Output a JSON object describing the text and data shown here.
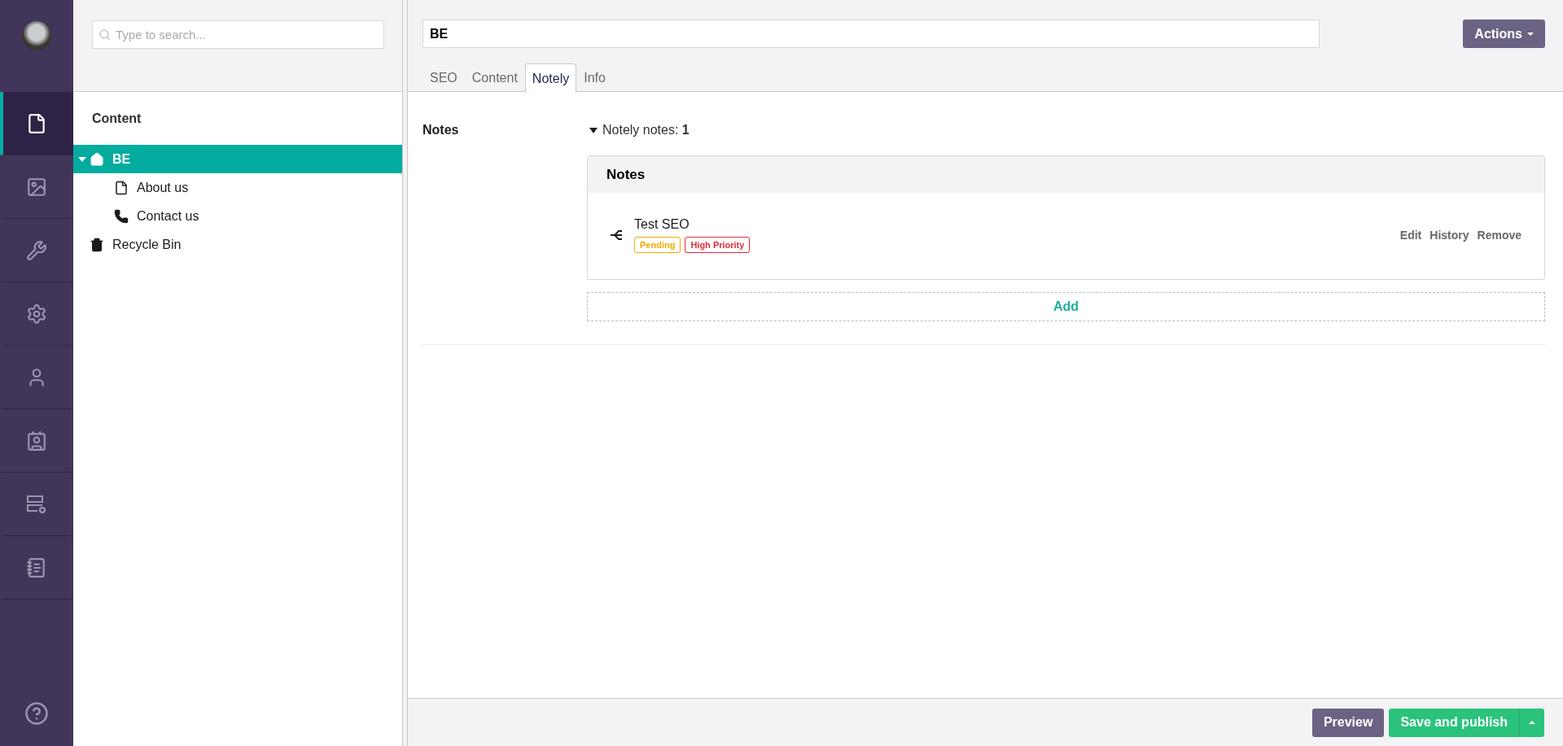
{
  "sidebar": {
    "sections": [
      {
        "kind": "content",
        "selected": true
      },
      {
        "kind": "media",
        "selected": false
      },
      {
        "kind": "tools",
        "selected": false
      },
      {
        "kind": "settings",
        "selected": false
      },
      {
        "kind": "users",
        "selected": false
      },
      {
        "kind": "members",
        "selected": false
      },
      {
        "kind": "forms",
        "selected": false
      },
      {
        "kind": "notes",
        "selected": false
      }
    ]
  },
  "tree": {
    "search": {
      "placeholder": "Type to search..."
    },
    "heading": "Content",
    "items": [
      {
        "label": "BE",
        "kind": "home",
        "selected": true,
        "expanded": true,
        "children": [
          {
            "label": "About us",
            "kind": "page",
            "selected": false
          },
          {
            "label": "Contact us",
            "kind": "phone",
            "selected": false
          }
        ]
      },
      {
        "label": "Recycle Bin",
        "kind": "trash",
        "selected": false
      }
    ]
  },
  "editor": {
    "name": "BE",
    "actions": "Actions",
    "tabs": [
      {
        "label": "SEO",
        "selected": false
      },
      {
        "label": "Content",
        "selected": false
      },
      {
        "label": "Notely",
        "selected": true
      },
      {
        "label": "Info",
        "selected": false
      }
    ],
    "property": {
      "label": "Notes",
      "toggle": {
        "text": "Notely notes: **1**",
        "expanded": true
      },
      "card_title": "Notes",
      "notes": [
        {
          "title": "Test SEO",
          "tags": [
            {
              "label": "Pending",
              "color": "#f0ac00"
            },
            {
              "label": "High Priority",
              "color": "#e22c3c"
            }
          ],
          "actions": [
            "Edit",
            "History",
            "Remove"
          ]
        }
      ],
      "add": "Add"
    }
  },
  "footer": {
    "preview": "Preview",
    "save": "Save and publish"
  }
}
